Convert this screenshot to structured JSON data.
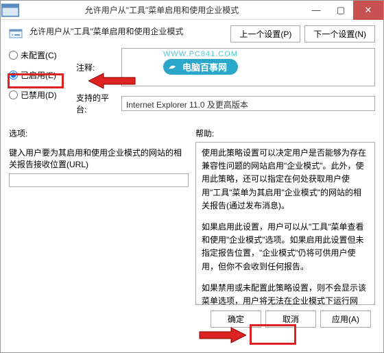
{
  "titlebar": {
    "title": "允许用户从\"工具\"菜单启用和使用企业模式"
  },
  "header": {
    "description": "允许用户从\"工具\"菜单启用和使用企业模式",
    "prev": "上一个设置(P)",
    "next": "下一个设置(N)"
  },
  "radios": {
    "notConfigured": "未配置(C)",
    "enabled": "已启用(E)",
    "disabled": "已禁用(D)",
    "selected": "enabled"
  },
  "fields": {
    "commentLabel": "注释:",
    "platformLabel": "支持的平台:",
    "platformValue": "Internet Explorer 11.0 及更高版本"
  },
  "watermark": {
    "url": "WWW.PC841.COM",
    "text": "电脑百事网"
  },
  "sections": {
    "options": "选项:",
    "help": "帮助:"
  },
  "options": {
    "urlLabel": "键入用户要为其启用和使用企业模式的网站的相关报告接收位置(URL)"
  },
  "help": {
    "p1": "使用此策略设置可以决定用户是否能够为存在兼容性问题的网站启用\"企业模式\"。此外，使用此策略，还可以指定在何处获取用户使用\"工具\"菜单为其启用\"企业模式\"的网站的相关报告(通过发布消息)。",
    "p2": "如果启用此设置，用户可以从\"工具\"菜单查看和使用\"企业模式\"选项。如果启用此设置但未指定报告位置，\"企业模式\"仍将可供用户使用，但你不会收到任何报告。",
    "p3": "如果禁用或未配置此策略设置，则不会显示该菜单选项，用户将无法在企业模式下运行网站。"
  },
  "buttons": {
    "ok": "确定",
    "cancel": "取消",
    "apply": "应用(A)"
  }
}
